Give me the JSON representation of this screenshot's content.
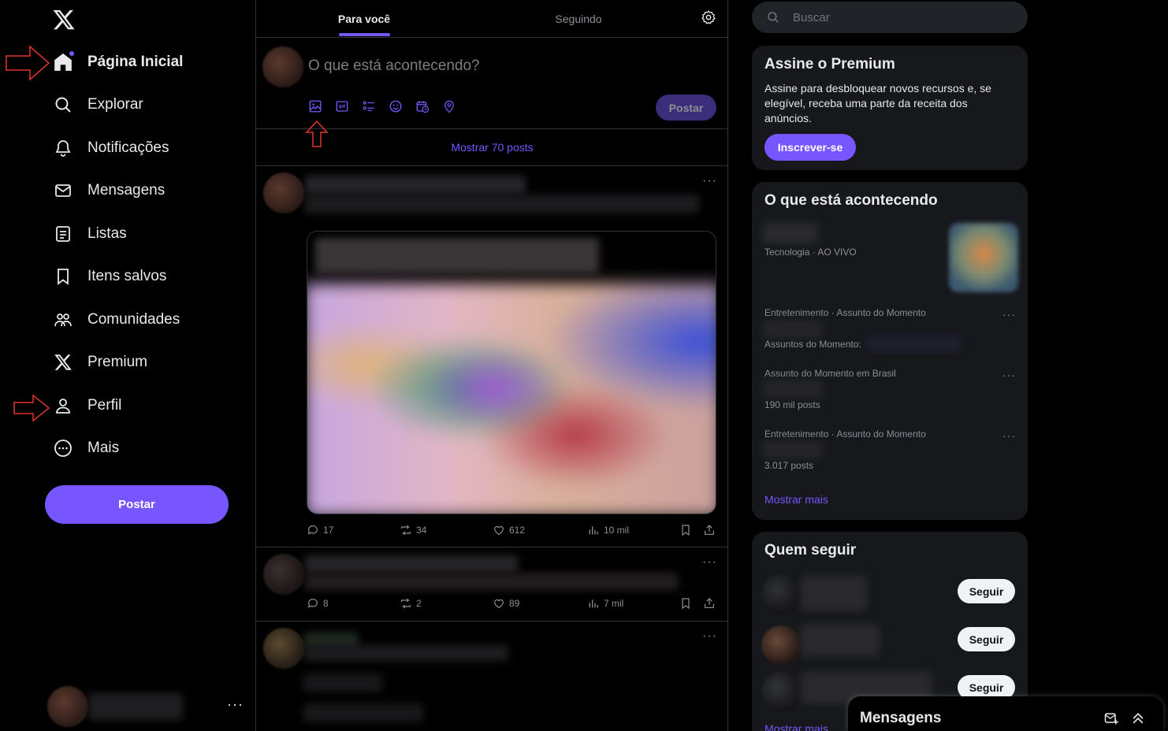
{
  "nav": {
    "items": [
      {
        "label": "Página Inicial",
        "icon": "home-icon",
        "active": true
      },
      {
        "label": "Explorar",
        "icon": "search-icon"
      },
      {
        "label": "Notificações",
        "icon": "bell-icon"
      },
      {
        "label": "Mensagens",
        "icon": "mail-icon"
      },
      {
        "label": "Listas",
        "icon": "list-icon"
      },
      {
        "label": "Itens salvos",
        "icon": "bookmark-icon"
      },
      {
        "label": "Comunidades",
        "icon": "communities-icon"
      },
      {
        "label": "Premium",
        "icon": "x-logo-icon"
      },
      {
        "label": "Perfil",
        "icon": "person-icon"
      },
      {
        "label": "Mais",
        "icon": "more-circle-icon"
      }
    ],
    "post_label": "Postar",
    "account_more": "···"
  },
  "tabs": {
    "for_you": "Para você",
    "following": "Seguindo"
  },
  "composer": {
    "placeholder": "O que está acontecendo?",
    "post_label": "Postar",
    "tools": [
      "image-icon",
      "gif-icon",
      "poll-icon",
      "emoji-icon",
      "schedule-icon",
      "location-icon"
    ]
  },
  "feed": {
    "show_posts": "Mostrar 70 posts",
    "posts": [
      {
        "replies": "17",
        "reposts": "34",
        "likes": "612",
        "views": "10 mil"
      },
      {
        "replies": "8",
        "reposts": "2",
        "likes": "89",
        "views": "7 mil"
      }
    ]
  },
  "search": {
    "placeholder": "Buscar"
  },
  "premium": {
    "title": "Assine o Premium",
    "description": "Assine para desbloquear novos recursos e, se elegível, receba uma parte da receita dos anúncios.",
    "button": "Inscrever-se"
  },
  "trends": {
    "title": "O que está acontecendo",
    "items": [
      {
        "context": "Tecnologia · AO VIVO"
      },
      {
        "context": "Entretenimento · Assunto do Momento",
        "extra": "Assuntos do Momento:"
      },
      {
        "context": "Assunto do Momento em Brasil",
        "count": "190 mil posts"
      },
      {
        "context": "Entretenimento · Assunto do Momento",
        "count": "3.017 posts"
      }
    ],
    "show_more": "Mostrar mais"
  },
  "who_to_follow": {
    "title": "Quem seguir",
    "follow_label": "Seguir",
    "show_more": "Mostrar mais"
  },
  "messages_drawer": {
    "title": "Mensagens"
  },
  "colors": {
    "accent": "#7856ff",
    "background": "#000000",
    "panel": "#16181c",
    "annotation_arrow": "#e0352b"
  }
}
